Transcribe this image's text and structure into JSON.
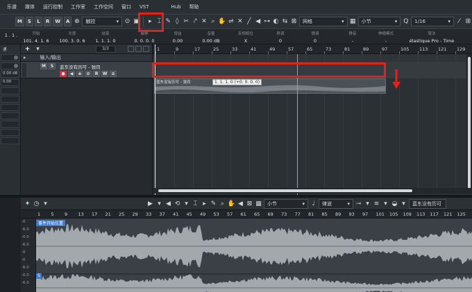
{
  "menubar": {
    "items": [
      "乐谱",
      "媒体",
      "运行控制",
      "工作室",
      "工作空间",
      "窗口",
      "VST",
      "Hub",
      "帮助"
    ]
  },
  "toolbar": {
    "mode_buttons": [
      "M",
      "S",
      "L",
      "R",
      "W",
      "A"
    ],
    "automation_mode": "触控",
    "snap_type": "网格",
    "grid_type": "小节",
    "quantize": "1/16"
  },
  "infoline": {
    "fields": [
      {
        "label": "",
        "value": "1 . 1 ."
      },
      {
        "label": "开始",
        "value": "101. 4. 1. 6"
      },
      {
        "label": "长度",
        "value": "100. 3. 0. 6"
      },
      {
        "label": "结束",
        "value": "1. 1. 1. 0"
      },
      {
        "label": "偏移",
        "value": "0. 0. 0. 0"
      },
      {
        "label": "增益",
        "value": "0.00"
      },
      {
        "label": "音量",
        "value": "0.00 dB"
      },
      {
        "label": "反相相位",
        "value": "X"
      },
      {
        "label": "移调",
        "value": "0"
      },
      {
        "label": "微调",
        "value": "0"
      },
      {
        "label": "静音",
        "value": "-"
      },
      {
        "label": "伸缩模式",
        "value": "-"
      },
      {
        "label": "算法",
        "value": "élastique Pro - Time"
      }
    ]
  },
  "inspector": {
    "tab": "通",
    "rows": [
      "",
      "",
      "",
      "0.00 dB",
      "0.00",
      "",
      "",
      "",
      "",
      "",
      "",
      ""
    ]
  },
  "tracklist": {
    "counter": "3/3",
    "folder_track": {
      "name": "输入/输出"
    },
    "audio_track": {
      "name": "蓝东没有历可 - 张同",
      "buttons": [
        "M",
        "S"
      ],
      "row2": [
        "●",
        "◀",
        "e",
        "⊘",
        "R",
        "W",
        "≡"
      ]
    }
  },
  "arrange": {
    "ruler_ticks": [
      "1",
      "9",
      "17",
      "25",
      "33",
      "41",
      "49",
      "57",
      "65",
      "73",
      "81",
      "89",
      "97",
      "105",
      "113",
      "121",
      "129"
    ],
    "part_name": "蓝东没有历可 - 张同",
    "tooltip": "1. 1. 1. 0 (+0. 0. 0. 0)"
  },
  "editor": {
    "snap_type": "小节",
    "view_mode": "律波",
    "track_name": "蓝东没有历可 - 张同",
    "ruler_ticks": [
      "1",
      "5",
      "9",
      "13",
      "17",
      "21",
      "25",
      "29",
      "33",
      "37",
      "41",
      "45",
      "49",
      "53",
      "57",
      "61",
      "65",
      "69",
      "73",
      "77",
      "81",
      "85",
      "89",
      "93",
      "97",
      "101",
      "105",
      "109",
      "113",
      "117",
      "121",
      "125"
    ],
    "db_labels": [
      "-0",
      "-6.0",
      "-0.0",
      "-6.0",
      "-0",
      "-0",
      "-6.0",
      "-0.0",
      "-6.0"
    ],
    "start_marker": "事件开始位置",
    "s_flag": "S"
  },
  "colors": {
    "highlight_red": "#e1231b",
    "record_red": "#c8343b",
    "marker_blue": "#3a7bd5"
  }
}
